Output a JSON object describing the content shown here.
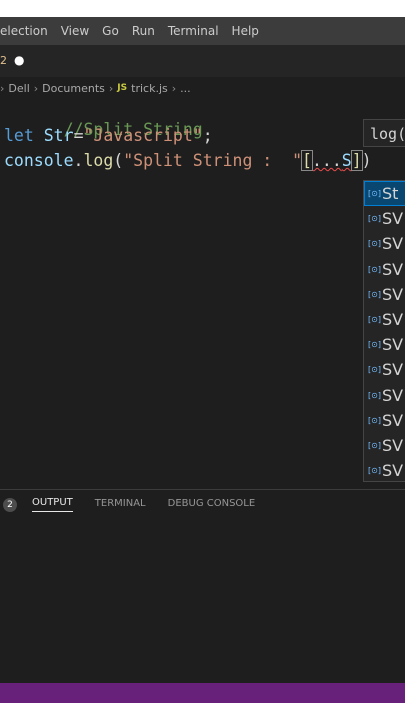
{
  "menubar": {
    "items": [
      "election",
      "View",
      "Go",
      "Run",
      "Terminal",
      "Help"
    ]
  },
  "tab": {
    "marker": "2",
    "dirty": "●"
  },
  "breadcrumb": {
    "lead": "›",
    "folder1": "Dell",
    "folder2": "Documents",
    "js_badge": "JS",
    "file": "trick.js",
    "more": "..."
  },
  "editor": {
    "line1": {
      "comment": "//Split String"
    },
    "line2": {
      "kw": "let",
      "var": "Str",
      "eq": "=",
      "str": "\"Javascript\"",
      "semi": ";"
    },
    "line3": {
      "obj": "console",
      "dot": ".",
      "fn": "log",
      "paren": "(",
      "str": "\"Split String :  \"",
      "bracket": "[",
      "spread": "...",
      "ident": "S",
      "bracket_close": "]",
      "paren_close": ")"
    }
  },
  "hint": {
    "text": "log("
  },
  "suggest": {
    "items": [
      {
        "icon": "[⊙]",
        "label": "St"
      },
      {
        "icon": "[⊙]",
        "label": "SV"
      },
      {
        "icon": "[⊙]",
        "label": "SV"
      },
      {
        "icon": "[⊙]",
        "label": "SV"
      },
      {
        "icon": "[⊙]",
        "label": "SV"
      },
      {
        "icon": "[⊙]",
        "label": "SV"
      },
      {
        "icon": "[⊙]",
        "label": "SV"
      },
      {
        "icon": "[⊙]",
        "label": "SV"
      },
      {
        "icon": "[⊙]",
        "label": "SV"
      },
      {
        "icon": "[⊙]",
        "label": "SV"
      },
      {
        "icon": "[⊙]",
        "label": "SV"
      },
      {
        "icon": "[⊙]",
        "label": "SV"
      }
    ]
  },
  "panel": {
    "badge": "2",
    "tabs": [
      "OUTPUT",
      "TERMINAL",
      "DEBUG CONSOLE"
    ]
  }
}
